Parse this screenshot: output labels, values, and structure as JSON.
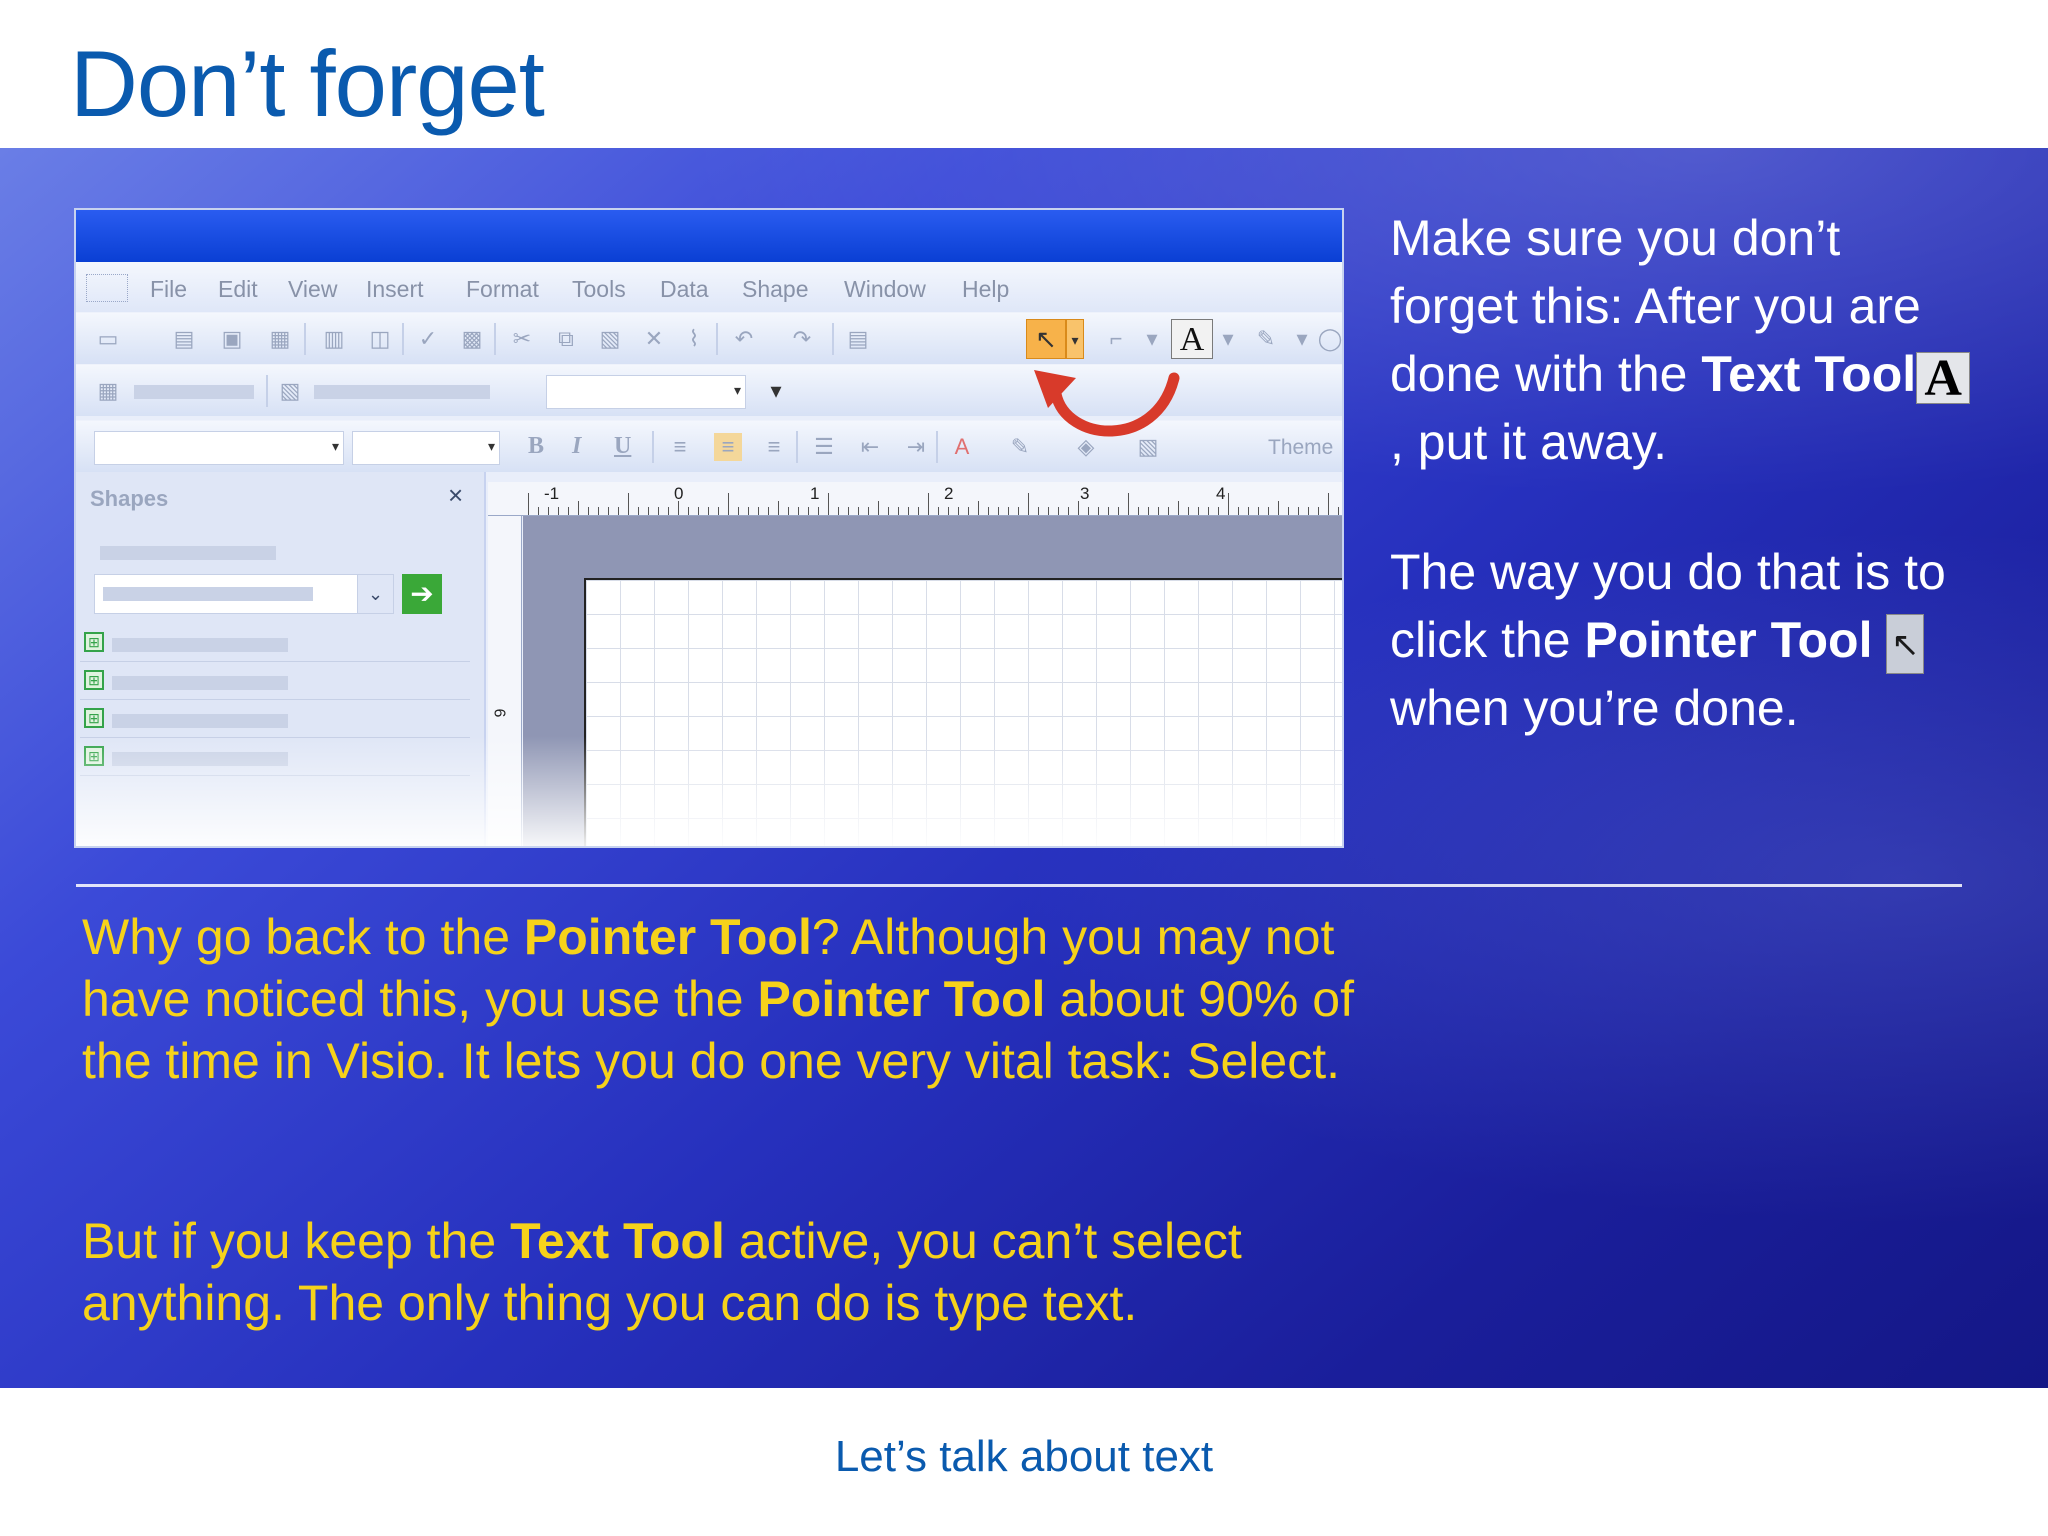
{
  "slide": {
    "title": "Don’t forget",
    "footer": "Let’s talk about text"
  },
  "screenshot": {
    "menu": [
      "File",
      "Edit",
      "View",
      "Insert",
      "Format",
      "Tools",
      "Data",
      "Shape",
      "Window",
      "Help"
    ],
    "text_tool_glyph": "A",
    "theme_label": "Theme",
    "shapes_pane": {
      "title": "Shapes",
      "close_glyph": "×"
    },
    "ruler_labels": [
      "-1",
      "0",
      "1",
      "2",
      "3",
      "4"
    ],
    "vruler_label": "6",
    "colors": {
      "pointer_highlight": "#f7b24a",
      "callout_arrow": "#d83a2a"
    }
  },
  "side_text": {
    "p1_a": "Make sure you don’t forget this: After you are done with the ",
    "p1_bold": "Text Tool",
    "p1_icon": "A",
    "p1_b": ", put it away.",
    "p2_a": "The way you do that is to click the ",
    "p2_bold": "Pointer Tool",
    "p2_b": " when you’re done."
  },
  "body_text": {
    "p1_a": "Why go back to the ",
    "p1_bold1": "Pointer Tool",
    "p1_b": "? Although you may not have noticed this, you use the ",
    "p1_bold2": "Pointer Tool",
    "p1_c": " about 90% of the time in Visio. It lets you do one very vital task: Select.",
    "p2_a": "But if you keep the ",
    "p2_bold": "Text Tool",
    "p2_b": " active, you can’t select anything. The only thing you can do is type text."
  },
  "colors": {
    "title": "#0a5aae",
    "body_yellow": "#f6d21a",
    "band": "#2630bd"
  }
}
